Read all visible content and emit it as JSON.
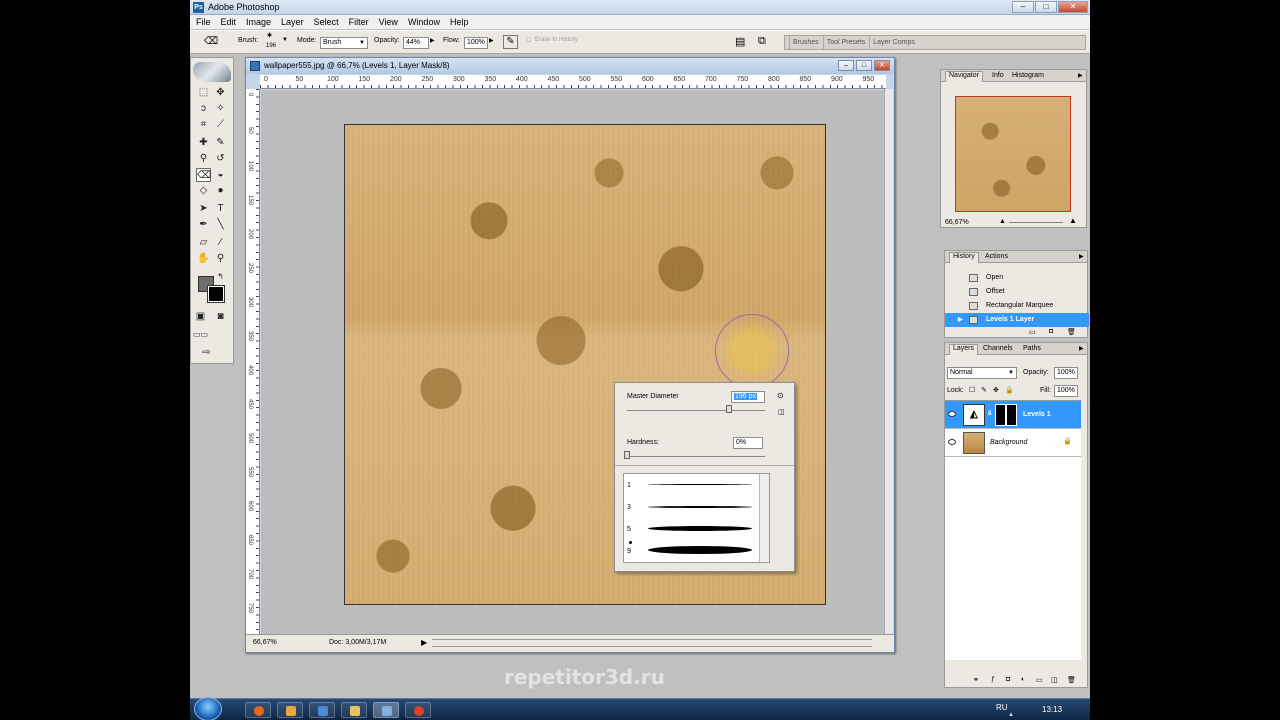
{
  "app": {
    "title": "Adobe Photoshop",
    "logo": "Ps"
  },
  "menu": [
    "File",
    "Edit",
    "Image",
    "Layer",
    "Select",
    "Filter",
    "View",
    "Window",
    "Help"
  ],
  "options": {
    "brush_label": "Brush:",
    "brush_size": "196",
    "mode_label": "Mode:",
    "mode_value": "Brush",
    "opacity_label": "Opacity:",
    "opacity_value": "44%",
    "flow_label": "Flow:",
    "flow_value": "100%",
    "erase_to_history": "Erase to History",
    "palette_tabs": [
      "Brushes",
      "Tool Presets",
      "Layer Comps"
    ]
  },
  "document": {
    "title": "wallpaper555.jpg @ 66,7% (Levels 1, Layer Mask/8)",
    "zoom": "66,67%",
    "doc_size": "Doc: 3,00M/3,17M",
    "ruler_ticks": [
      "0",
      "50",
      "100",
      "150",
      "200",
      "250",
      "300",
      "350",
      "400",
      "450",
      "500",
      "550",
      "600",
      "650",
      "700",
      "750",
      "800",
      "850",
      "900",
      "950"
    ],
    "vruler_ticks": [
      "0",
      "50",
      "100",
      "150",
      "200",
      "250",
      "300",
      "350",
      "400",
      "450",
      "500",
      "550",
      "600",
      "650",
      "700",
      "750"
    ]
  },
  "brush_popup": {
    "master_diameter_label": "Master Diameter",
    "master_diameter_value": "196 px",
    "hardness_label": "Hardness:",
    "hardness_value": "0%",
    "brushes": [
      {
        "num": "1",
        "dot": false
      },
      {
        "num": "3",
        "dot": false
      },
      {
        "num": "5",
        "dot": false
      },
      {
        "num": "9",
        "dot": true
      }
    ]
  },
  "navigator": {
    "tabs": [
      "Navigator",
      "Info",
      "Histogram"
    ],
    "zoom": "66,67%"
  },
  "history": {
    "tabs": [
      "History",
      "Actions"
    ],
    "items": [
      {
        "label": "Open",
        "selected": false
      },
      {
        "label": "Offset",
        "selected": false
      },
      {
        "label": "Rectangular Marquee",
        "selected": false
      },
      {
        "label": "Levels 1 Layer",
        "selected": true
      }
    ]
  },
  "layers": {
    "tabs": [
      "Layers",
      "Channels",
      "Paths"
    ],
    "blend_mode": "Normal",
    "opacity_label": "Opacity:",
    "opacity_value": "100%",
    "lock_label": "Lock:",
    "fill_label": "Fill:",
    "fill_value": "100%",
    "items": [
      {
        "name": "Levels 1",
        "selected": true
      },
      {
        "name": "Background",
        "selected": false
      }
    ]
  },
  "taskbar": {
    "lang": "RU",
    "clock": "13:13"
  },
  "watermark": "repetitor3d.ru",
  "colors": {
    "selection": "#3399ff",
    "chrome": "#ece9e3",
    "canvas_bg": "#c0c0c0"
  }
}
